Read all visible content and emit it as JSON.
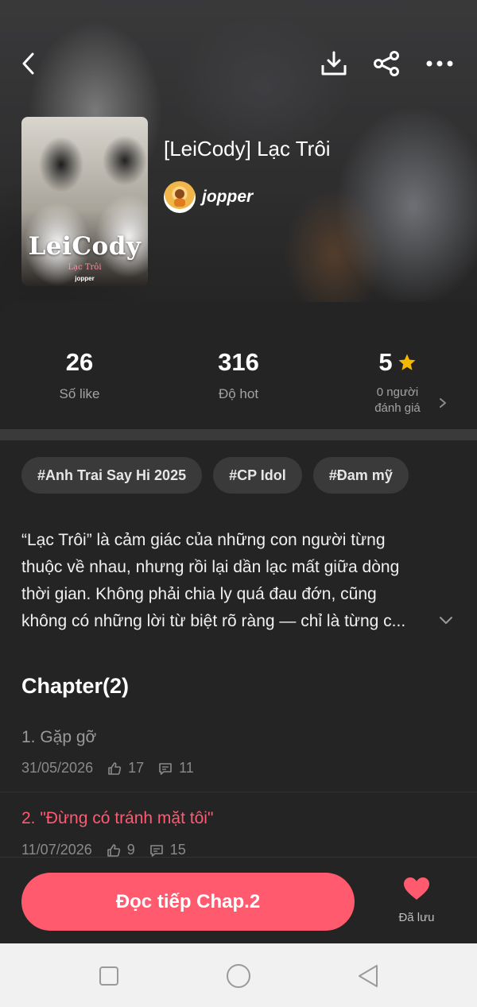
{
  "header": {
    "back_icon": "chevron-left-icon",
    "download_icon": "download-icon",
    "share_icon": "share-icon",
    "more_icon": "more-horizontal-icon"
  },
  "story": {
    "title": "[LeiCody] Lạc Trôi",
    "author": "jopper",
    "cover": {
      "title": "LeiCody",
      "subtitle": "Lạc Trôi",
      "author": "jopper"
    }
  },
  "stats": {
    "likes": {
      "value": "26",
      "label": "Số like"
    },
    "hot": {
      "value": "316",
      "label": "Độ hot"
    },
    "rating": {
      "value": "5",
      "label_line1": "0 người",
      "label_line2": "đánh giá",
      "icon": "star-icon",
      "icon_color": "#f5b800"
    }
  },
  "tags": [
    "#Anh Trai Say Hi 2025",
    "#CP Idol",
    "#Đam mỹ"
  ],
  "description": {
    "lines": [
      "“Lạc Trôi” là cảm giác của những con người từng",
      "thuộc về nhau, nhưng rồi lại dần lạc mất giữa dòng",
      "thời gian. Không phải chia ly quá đau đớn, cũng",
      "không có những lời từ biệt rõ ràng — chỉ là từng c..."
    ]
  },
  "chapters": {
    "heading": "Chapter(2)",
    "items": [
      {
        "title": "1. Gặp gỡ",
        "date": "31/05/2026",
        "likes": "17",
        "comments": "11",
        "active": false
      },
      {
        "title": "2. \"Đừng có tránh mặt tôi\"",
        "date": "11/07/2026",
        "likes": "9",
        "comments": "15",
        "active": true
      }
    ]
  },
  "actions": {
    "read_label": "Đọc tiếp Chap.2",
    "save_label": "Đã lưu",
    "accent_color": "#ff5a6e"
  }
}
